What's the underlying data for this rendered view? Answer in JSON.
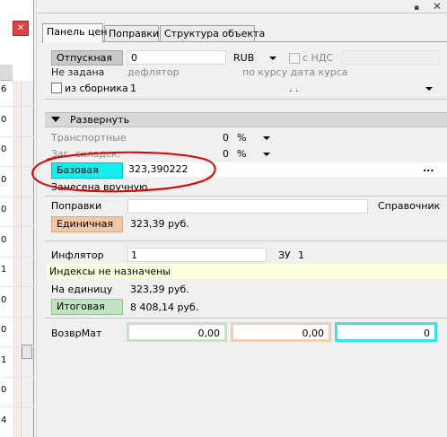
{
  "left_grid": {
    "row_numbers": [
      "6",
      "0",
      "0",
      "0",
      "0",
      "0",
      "1",
      "0",
      "0",
      "1",
      "0",
      "4"
    ]
  },
  "tabs": [
    {
      "label": "Панель цен"
    },
    {
      "label": "Поправки"
    },
    {
      "label": "Структура объекта"
    }
  ],
  "price_type": {
    "button": "Отпускная",
    "value": "0",
    "currency": "RUB",
    "vat_label": "с НДС",
    "status": "Не задана",
    "deflator_label": "дефлятор",
    "rate_label": "по курсу дата курса"
  },
  "from_collection": {
    "label": "из сборника",
    "value": "1",
    "date_value": ". ."
  },
  "expand": {
    "label": "Развернуть"
  },
  "transport": {
    "label": "Транспортные",
    "value": "0",
    "unit": "%"
  },
  "procurement": {
    "label": "Заг.-складск.",
    "value": "0",
    "unit": "%"
  },
  "base": {
    "button": "Базовая",
    "value": "323,390222",
    "note": "Занесена вручную",
    "more": "..."
  },
  "corrections": {
    "label": "Поправки",
    "reference": "Справочник"
  },
  "unit_price": {
    "button": "Единичная",
    "value": "323,39 руб."
  },
  "inflator": {
    "label": "Инфлятор",
    "value": "1",
    "code": "ЗУ",
    "code_value": "1"
  },
  "indices_note": "Индексы не назначены",
  "per_unit": {
    "label": "На единицу",
    "value": "323,39 руб."
  },
  "total": {
    "button": "Итоговая",
    "value": "8 408,14 руб."
  },
  "return_materials": {
    "label": "ВозврМат",
    "values": [
      "0,00",
      "0,00",
      "0"
    ]
  },
  "colors": {
    "base_cyan": "#18ecec",
    "unit_peach": "#f0c8a8",
    "total_green": "#c0e4c0",
    "annotation_red": "#e00000",
    "notice_yellow": "#ffffe0"
  }
}
